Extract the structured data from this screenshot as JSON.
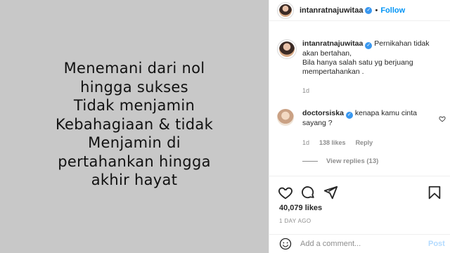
{
  "post_image": {
    "text": "Menemani dari nol\nhingga sukses\nTidak menjamin\nKebahagiaan & tidak\nMenjamin di\npertahankan hingga\nakhir hayat"
  },
  "header": {
    "username": "intanratnajuwitaa",
    "separator": "•",
    "follow_label": "Follow"
  },
  "caption": {
    "username": "intanratnajuwitaa",
    "text": "Pernikahan tidak\nakan bertahan,\nBila hanya salah satu yg berjuang\nmempertahankan .",
    "time": "1d"
  },
  "comment": {
    "username": "doctorsiska",
    "text": "kenapa kamu cinta sayang ?",
    "time": "1d",
    "likes": "138 likes",
    "reply_label": "Reply",
    "view_replies": "View replies (13)"
  },
  "likes": "40,079 likes",
  "date": "1 DAY AGO",
  "add_comment": {
    "placeholder": "Add a comment...",
    "post_label": "Post"
  },
  "colors": {
    "accent": "#0095f6",
    "image_bg": "#c8c8c8",
    "muted": "#8e8e8e"
  }
}
